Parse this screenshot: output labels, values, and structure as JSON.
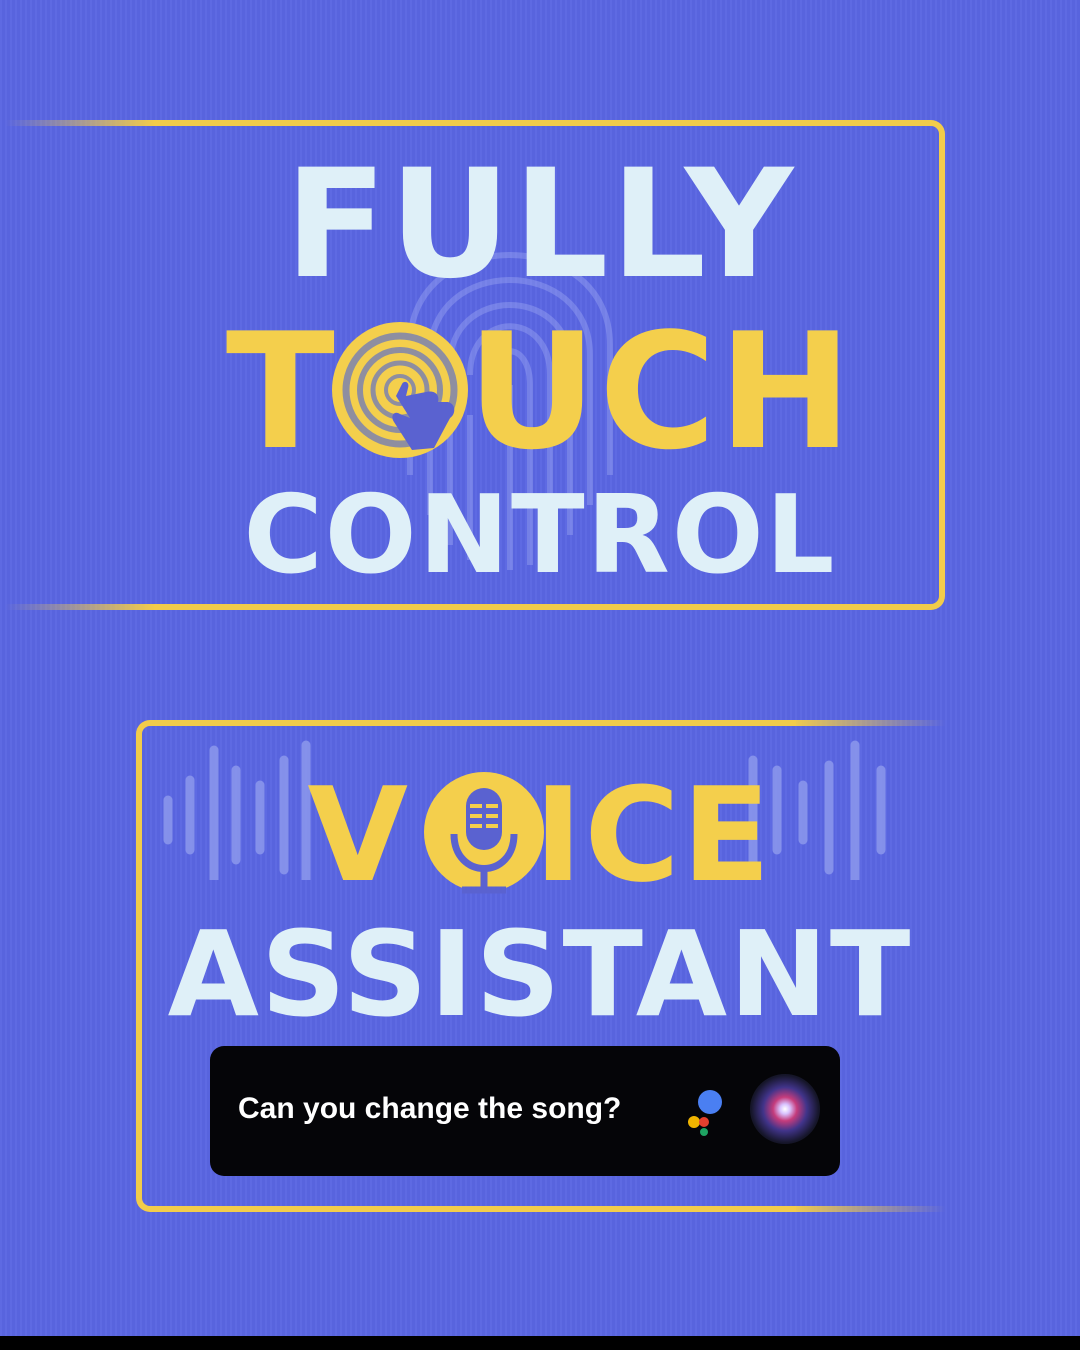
{
  "touch_panel": {
    "line1": "FULLY",
    "line2_left": "T",
    "line2_right": "UCH",
    "line3": "CONTROL"
  },
  "voice_panel": {
    "line1_left": "V",
    "line1_right": "ICE",
    "line2": "ASSISTANT"
  },
  "prompt": {
    "text": "Can you change the song?"
  },
  "icons": {
    "fingerprint": "fingerprint-icon",
    "touch": "tap-finger-icon",
    "mic": "microphone-icon",
    "google_assistant": "google-assistant-icon",
    "siri": "siri-icon"
  },
  "colors": {
    "background": "#5a66e2",
    "accent_yellow": "#f4cf4c",
    "text_light": "#dff0f8"
  }
}
